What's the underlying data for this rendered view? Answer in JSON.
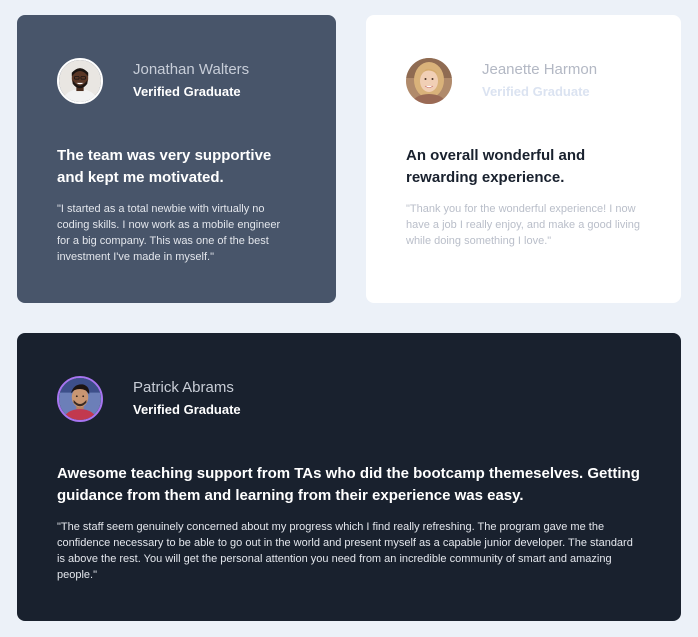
{
  "testimonials": [
    {
      "name": "Jonathan Walters",
      "role": "Verified Graduate",
      "headline": "The team was very supportive and kept me motivated.",
      "quote": "\"I started as a total newbie with virtually no coding skills. I now work as a mobile engineer for a big company. This was one of the best investment I've made in myself.\"",
      "avatar_icon": "avatar-jonathan",
      "card_color": "#48556a"
    },
    {
      "name": "Jeanette Harmon",
      "role": "Verified Graduate",
      "headline": "An overall wonderful and rewarding experience.",
      "quote": "\"Thank you for the wonderful experience! I now have a job I really enjoy, and make a good living while doing something I love.\"",
      "avatar_icon": "avatar-jeanette",
      "card_color": "#ffffff"
    },
    {
      "name": "Patrick Abrams",
      "role": "Verified Graduate",
      "headline": "Awesome teaching support from TAs who did the bootcamp themeselves. Getting guidance from them and learning from their experience was easy.",
      "quote": "\"The staff seem genuinely concerned about my progress which I find really refreshing. The program gave me the confidence necessary to be able to go out in the world and present myself as a capable junior developer. The standard is above the rest. You will get the personal attention you need from an incredible community of smart and amazing people.\"",
      "avatar_icon": "avatar-patrick",
      "card_color": "#19212e"
    }
  ]
}
